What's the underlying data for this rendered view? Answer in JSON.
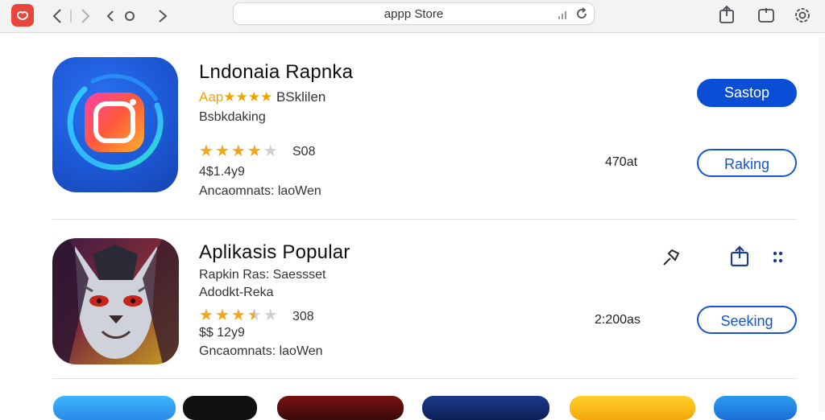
{
  "browser": {
    "url": "appp Store"
  },
  "apps": [
    {
      "title": "Lndonaia Rapnka",
      "tagline_accent": "Aap★★★★",
      "tagline_rest": " BSklilen",
      "subtitle": "Bsbkdaking",
      "rating_text": "S08",
      "rating": 4,
      "price": "4$1.4y9",
      "developer": "Ancaomnats: laoWen",
      "size": "470at",
      "primary_label": "Sastop",
      "secondary_label": "Raking",
      "brand_color": "#0a4ed6"
    },
    {
      "title": "Aplikasis Popular",
      "subtitle": "Rapkin  Ras: Saessset",
      "subtitle2": "Adodkt-Reka",
      "rating_text": "308",
      "rating": 3.5,
      "price": "$$ 12y9",
      "developer": "Gncaomnats: laoWen",
      "size": "2:200as",
      "secondary_label": "Seeking"
    }
  ],
  "icons": {
    "back": "chevron-left-icon",
    "forward": "chevron-right-icon",
    "refresh": "reload-icon",
    "share": "share-icon",
    "tabs": "tabs-icon",
    "settings": "gear-icon",
    "pin": "pin-icon",
    "more": "more-dots-icon"
  }
}
